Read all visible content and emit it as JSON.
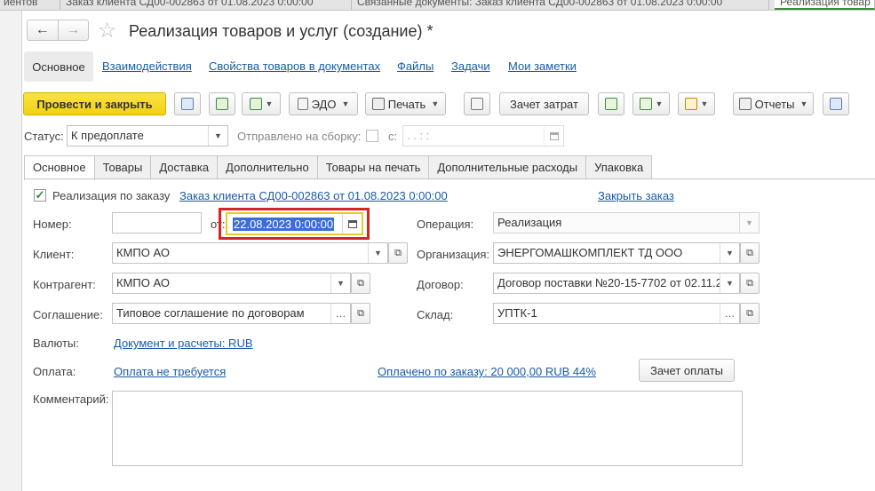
{
  "top_tabs": [
    "иентов",
    "Заказ клиента СД00-002863 от 01.08.2023 0:00:00",
    "Связанные документы: Заказ клиента СД00-002863 от 01.08.2023 0:00:00",
    "Реализация товар"
  ],
  "window": {
    "title": "Реализация товаров и услуг (создание) *",
    "back_icon": "←",
    "forward_icon": "→",
    "star_icon": "☆"
  },
  "sections": [
    "Основное",
    "Взаимодействия",
    "Свойства товаров в документах",
    "Файлы",
    "Задачи",
    "Мои заметки"
  ],
  "toolbar": {
    "post_close": "Провести и закрыть",
    "edo": "ЭДО",
    "print": "Печать",
    "cost_offset": "Зачет затрат",
    "reports": "Отчеты"
  },
  "status": {
    "label": "Статус:",
    "value": "К предоплате",
    "sent_label": "Отправлено на сборку:",
    "since_label": "с:",
    "since_value": ".  .       :  :"
  },
  "tabs": [
    "Основное",
    "Товары",
    "Доставка",
    "Дополнительно",
    "Товары на печать",
    "Дополнительные расходы",
    "Упаковка"
  ],
  "form": {
    "by_order_label": "Реализация по заказу",
    "order_link": "Заказ клиента СД00-002863 от 01.08.2023 0:00:00",
    "close_order_link": "Закрыть заказ",
    "number_label": "Номер:",
    "number_value": "",
    "from_label": "от:",
    "date_value": "22.08.2023  0:00:00",
    "operation_label": "Операция:",
    "operation_value": "Реализация",
    "client_label": "Клиент:",
    "client_value": "КМПО АО",
    "org_label": "Организация:",
    "org_value": "ЭНЕРГОМАШКОМПЛЕКТ ТД ООО",
    "counterparty_label": "Контрагент:",
    "counterparty_value": "КМПО АО",
    "contract_label": "Договор:",
    "contract_value": "Договор поставки №20-15-7702 от 02.11.2",
    "agreement_label": "Соглашение:",
    "agreement_value": "Типовое соглашение по договорам",
    "warehouse_label": "Склад:",
    "warehouse_value": "УПТК-1",
    "currency_label": "Валюты:",
    "currency_link": "Документ и расчеты: RUB",
    "payment_label": "Оплата:",
    "payment_link": "Оплата не требуется",
    "paid_link": "Оплачено по заказу: 20 000,00 RUB  44%",
    "payment_offset_button": "Зачет оплаты",
    "comment_label": "Комментарий:",
    "comment_value": ""
  }
}
